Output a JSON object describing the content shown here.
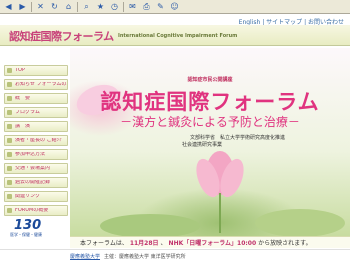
{
  "toolbar": {
    "icons": [
      "back-icon",
      "forward-icon",
      "stop-icon",
      "refresh-icon",
      "home-icon",
      "search-icon",
      "favorites-icon",
      "history-icon",
      "mail-icon",
      "print-icon",
      "edit-icon",
      "messenger-icon"
    ]
  },
  "toplinks": "English | サイトマップ | お問い合わせ",
  "header": {
    "logo": "認知症国際フォーラム",
    "subtitle": "International Cognitive Impairment Forum"
  },
  "sidebar": {
    "items": [
      {
        "label": "TOP"
      },
      {
        "label": "お知らせ フォーラムのお知らせ"
      },
      {
        "label": "概　要"
      },
      {
        "label": "プログラム"
      },
      {
        "label": "講　演"
      },
      {
        "label": "演者・座長の ご紹介"
      },
      {
        "label": "参加申込方法"
      },
      {
        "label": "交通・会場案内"
      },
      {
        "label": "過去の開催記録"
      },
      {
        "label": "関連リンク"
      },
      {
        "label": "FORUMの概要"
      }
    ]
  },
  "badge": {
    "number": "130",
    "sub": "医学・保健・健康"
  },
  "banner": {
    "kicker": "認知症市民公開講座",
    "title": "認知症国際フォーラム",
    "subtitle": "－漢方と鍼灸による予防と治療－",
    "sponsor1": "文部科学省　私立大学学術研究高度化推進",
    "sponsor2": "社会連携研究事業"
  },
  "announce": {
    "prefix": "本フォーラムは、",
    "date": "11月28日",
    "middle": "、",
    "program": "NHK「日曜フォーラム」10:00",
    "suffix": "から放映されます。"
  },
  "footer": {
    "link": "慶應義塾大学",
    "text": "主催：慶應義塾大学 東洋医学研究所"
  }
}
